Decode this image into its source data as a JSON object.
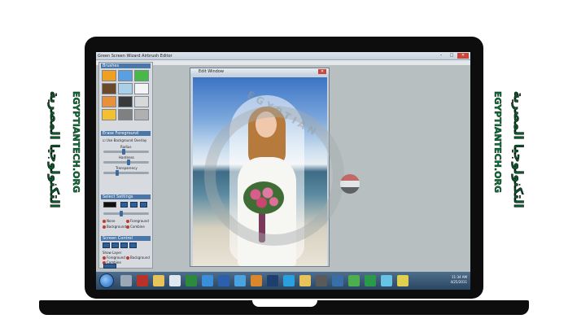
{
  "app": {
    "title": "Green Screen Wizard Airbrush Editor",
    "window_controls": [
      "–",
      "□",
      "✕"
    ]
  },
  "left_panel": {
    "brushes_header": "Brushes",
    "brush_swatches": [
      "#f0a020",
      "#5aa0e0",
      "#48b848",
      "#6a4a2a",
      "#a8d0e8",
      "#f4f4f4",
      "#e8903a",
      "#3a3a3a",
      "#d8d8d8",
      "#f2c030",
      "#808080",
      "#b0b0b0"
    ],
    "erase_foreground_header": "Erase Foreground",
    "erase_option": "Use Background Overlay",
    "sliders": [
      {
        "label": "Radius",
        "value": 0.45
      },
      {
        "label": "Hardness",
        "value": 0.55
      },
      {
        "label": "Transparency",
        "value": 0.3
      }
    ],
    "select_settings_header": "Select Settings",
    "select_radios": [
      "None",
      "Foreground",
      "Background",
      "Combine"
    ],
    "screen_control_header": "Screen Control",
    "show_layer_label": "Show Layer",
    "screen_radios": [
      "Foreground",
      "Background",
      "Combine"
    ]
  },
  "edit_window": {
    "title": "Edit Window",
    "close": "✕"
  },
  "watermark": {
    "text": "EGYPTIAN"
  },
  "taskbar": {
    "icons": [
      {
        "name": "tools-icon",
        "color": "#9aa7b4"
      },
      {
        "name": "filezilla-icon",
        "color": "#b8322a"
      },
      {
        "name": "folder-icon",
        "color": "#e8c25a"
      },
      {
        "name": "document-icon",
        "color": "#dfe7ef"
      },
      {
        "name": "excel-icon",
        "color": "#2c8a3d"
      },
      {
        "name": "ie-icon",
        "color": "#3a8fd8"
      },
      {
        "name": "word-icon",
        "color": "#2d5faf"
      },
      {
        "name": "chat-icon",
        "color": "#4aa3df"
      },
      {
        "name": "media-icon",
        "color": "#d9862c"
      },
      {
        "name": "photoshop-icon",
        "color": "#1e3f6e"
      },
      {
        "name": "skype-icon",
        "color": "#2aa0e0"
      },
      {
        "name": "folder-icon",
        "color": "#e8c25a"
      },
      {
        "name": "app-icon",
        "color": "#5a5a5a"
      },
      {
        "name": "app-icon",
        "color": "#3a6ea8"
      },
      {
        "name": "shield-icon",
        "color": "#4cae4c"
      },
      {
        "name": "pen-icon",
        "color": "#2a9a4a"
      },
      {
        "name": "app-icon",
        "color": "#67c3e6"
      },
      {
        "name": "app-icon",
        "color": "#e0d050"
      }
    ],
    "time": "11:34 AM",
    "date": "4/25/2011"
  },
  "branding": {
    "arabic": "التكنولوجيا المصرية",
    "latin": "EGYPTIANTECH.ORG"
  }
}
